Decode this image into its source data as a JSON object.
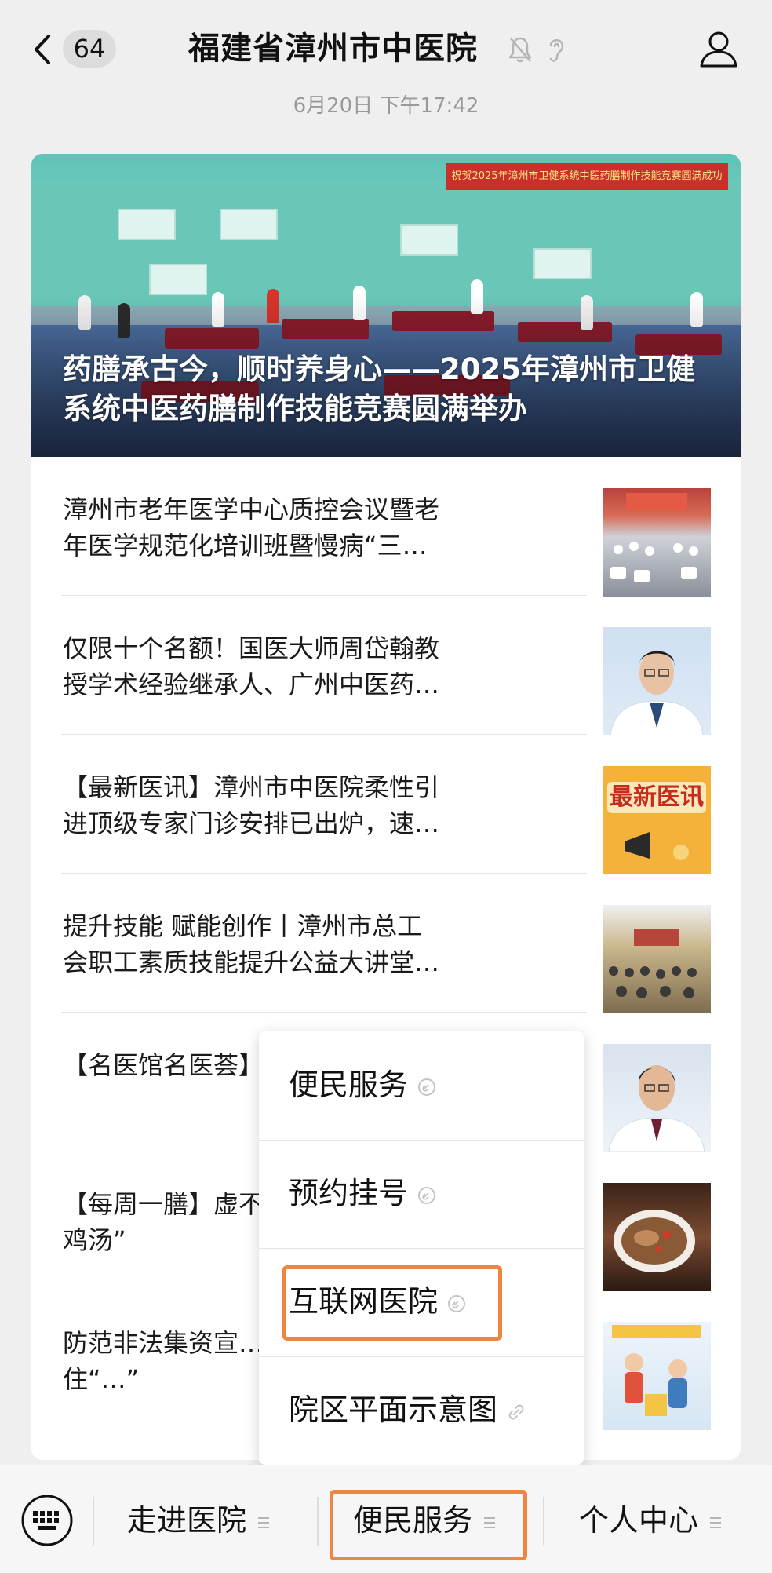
{
  "header": {
    "back_badge": "64",
    "title": "福建省漳州市中医院",
    "timestamp": "6月20日 下午17:42"
  },
  "hero": {
    "banner": "祝贺2025年漳州市卫健系统中医药膳制作技能竞赛圆满成功",
    "title": "药膳承古今，顺时养身心——2025年漳州市卫健系统中医药膳制作技能竞赛圆满举办"
  },
  "articles": [
    {
      "title": "漳州市老年医学中心质控会议暨老年医学规范化培训班暨慢病“三师共管”高…",
      "thumb": "conference-photo"
    },
    {
      "title": "仅限十个名额！国医大师周岱翰教授学术经验继承人、广州中医药大学第一…",
      "thumb": "doctor-portrait"
    },
    {
      "title": "【最新医讯】漳州市中医院柔性引进顶级专家门诊安排已出炉，速速约起~",
      "thumb": "news-badge",
      "thumb_text": "最新医讯"
    },
    {
      "title": "提升技能 赋能创作丨漳州市总工会职工素质技能提升公益大讲堂解锁短视频…",
      "thumb": "lecture-hall-photo"
    },
    {
      "title": "【名医馆名医荟】…欣",
      "thumb": "doctor-portrait"
    },
    {
      "title": "【每周一膳】虚不…试这碗“佛系鸡汤”",
      "thumb": "soup-photo"
    },
    {
      "title": "防范非法集资宣…资口诀，守住“…”",
      "thumb": "cartoon-poster"
    }
  ],
  "popup_menu": {
    "items": [
      {
        "label": "便民服务"
      },
      {
        "label": "预约挂号"
      },
      {
        "label": "互联网医院",
        "highlighted": true
      },
      {
        "label": "院区平面示意图"
      }
    ]
  },
  "bottom_bar": {
    "tabs": [
      {
        "label": "走进医院"
      },
      {
        "label": "便民服务",
        "highlighted": true
      },
      {
        "label": "个人中心"
      }
    ]
  },
  "colors": {
    "highlight": "#ef8540",
    "background": "#efefef",
    "card": "#ffffff"
  }
}
